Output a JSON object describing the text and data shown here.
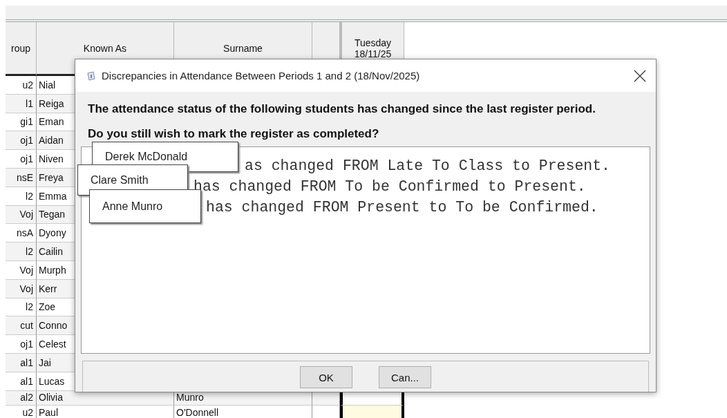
{
  "table": {
    "columns": [
      "roup",
      "Known As",
      "Surname",
      "Tuesday 18/11/25"
    ],
    "rows": [
      {
        "group": "u2",
        "known_as": "Nial"
      },
      {
        "group": "l1",
        "known_as": "Reiga"
      },
      {
        "group": "gi1",
        "known_as": "Eman"
      },
      {
        "group": "oj1",
        "known_as": "Aidan"
      },
      {
        "group": "oj1",
        "known_as": "Niven"
      },
      {
        "group": "nsE",
        "known_as": "Freya"
      },
      {
        "group": "l2",
        "known_as": "Emma"
      },
      {
        "group": "Voj",
        "known_as": "Tegan"
      },
      {
        "group": "nsA",
        "known_as": "Dyony"
      },
      {
        "group": "l2",
        "known_as": "Cailin"
      },
      {
        "group": "Voj",
        "known_as": "Murph"
      },
      {
        "group": "Voj",
        "known_as": "Kerr"
      },
      {
        "group": "l2",
        "known_as": "Zoe"
      },
      {
        "group": "cut",
        "known_as": "Conno"
      },
      {
        "group": "oj1",
        "known_as": "Celest"
      },
      {
        "group": "al1",
        "known_as": "Jai"
      },
      {
        "group": "al1",
        "known_as": "Lucas"
      },
      {
        "group": "al2",
        "known_as": "Olivia",
        "surname": "Munro",
        "highlighted": false
      },
      {
        "group": "u2",
        "known_as": "Paul",
        "surname": "O'Donnell",
        "highlighted": true
      }
    ]
  },
  "dialog": {
    "title": "Discrepancies in Attendance Between Periods 1 and 2 (18/Nov/2025)",
    "message": "The attendance status of the following students has changed since the last register period.",
    "question": "Do you still wish to mark the register as completed?",
    "details": [
      "as changed FROM Late To Class to Present.",
      "has changed FROM To be Confirmed to Present.",
      "has changed FROM Present to To be Confirmed."
    ],
    "tooltips": [
      "Derek McDonald",
      "Clare Smith",
      "Anne Munro"
    ],
    "buttons": [
      "OK",
      "Can..."
    ]
  }
}
